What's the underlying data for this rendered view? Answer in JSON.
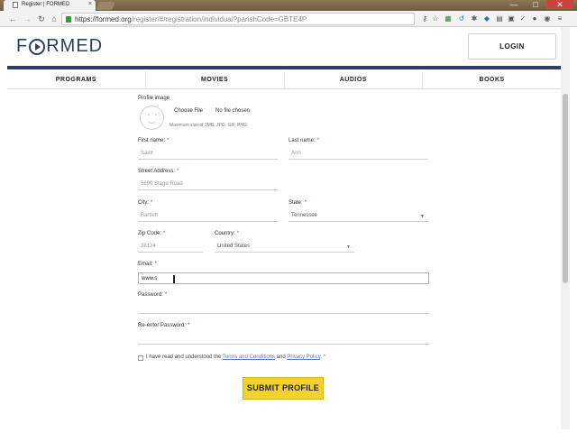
{
  "browser": {
    "tab_title": "Register | FORMED",
    "url_host": "https://formed.org",
    "url_path": "/register/#/registration/individual?parishCode=GBTE4P",
    "win_minimize": "—",
    "win_maximize": "□",
    "win_close": "✕",
    "tab_close": "×"
  },
  "header": {
    "logo_text_1": "F",
    "logo_text_2": "RMED",
    "login_label": "LOGIN"
  },
  "nav": {
    "items": [
      "PROGRAMS",
      "MOVIES",
      "AUDIOS",
      "BOOKS"
    ]
  },
  "form": {
    "profile_image_label": "Profile image",
    "choose_file_label": "Choose File",
    "no_file_label": "No file chosen",
    "file_hint": "Maximum size of 3MB. JPG, GIF, PNG.",
    "first_name_label": "First name:",
    "first_name_value": "Saint",
    "last_name_label": "Last name:",
    "last_name_value": "Ann",
    "street_label": "Street Address:",
    "street_value": "5690 Stage Road",
    "city_label": "City:",
    "city_value": "Bartlett",
    "state_label": "State:",
    "state_value": "Tennessee",
    "zip_label": "Zip Code:",
    "zip_value": "38134",
    "country_label": "Country:",
    "country_value": "United States",
    "email_label": "Email:",
    "email_value": "www.s",
    "password_label": "Password:",
    "password_value": "",
    "reenter_label": "Re-enter Password:",
    "reenter_value": "",
    "required_mark": "*",
    "terms_prefix": "I have read and understood the",
    "terms_link": "Terms and Conditions",
    "terms_and": "and",
    "privacy_link": "Privacy Policy",
    "terms_suffix": ".",
    "submit_label": "SUBMIT PROFILE"
  },
  "colors": {
    "brand_navy": "#2c3e63",
    "submit_yellow": "#f3d12e",
    "required_red": "#cc3333",
    "link_blue": "#5a7ab8"
  }
}
